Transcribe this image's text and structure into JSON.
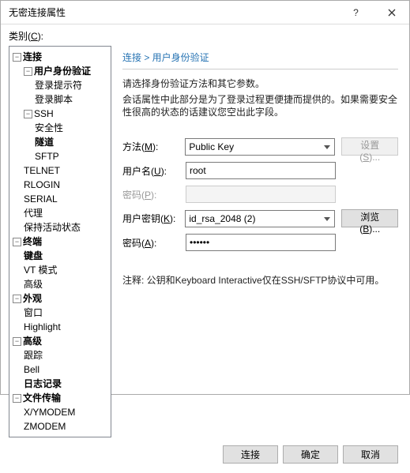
{
  "window": {
    "title": "无密连接属性"
  },
  "category_label": "类别",
  "category_hotkey": "C",
  "tree": {
    "conn": "连接",
    "auth": "用户身份验证",
    "loginprompt": "登录提示符",
    "loginscript": "登录脚本",
    "ssh": "SSH",
    "security": "安全性",
    "tunnel": "隧道",
    "sftp": "SFTP",
    "telnet": "TELNET",
    "rlogin": "RLOGIN",
    "serial": "SERIAL",
    "proxy": "代理",
    "keepalive": "保持活动状态",
    "terminal": "终端",
    "keyboard": "键盘",
    "vt": "VT 模式",
    "advanced1": "高级",
    "appearance": "外观",
    "windowitem": "窗口",
    "highlight": "Highlight",
    "advanced2": "高级",
    "trace": "跟踪",
    "bell": "Bell",
    "logging": "日志记录",
    "filetx": "文件传输",
    "xymodem": "X/YMODEM",
    "zmodem": "ZMODEM"
  },
  "breadcrumb": "连接 > 用户身份验证",
  "desc": "请选择身份验证方法和其它参数。",
  "hint": "会话属性中此部分是为了登录过程更便捷而提供的。如果需要安全性很高的状态的话建议您空出此字段。",
  "labels": {
    "method": "方法",
    "method_hk": "M",
    "user": "用户名",
    "user_hk": "U",
    "pass": "密码",
    "pass_hk": "P",
    "userkey": "用户密钥",
    "userkey_hk": "K",
    "passphrase": "密码",
    "passphrase_hk": "A"
  },
  "values": {
    "method": "Public Key",
    "user": "root",
    "pass": "",
    "userkey": "id_rsa_2048 (2)",
    "passphrase": "••••••"
  },
  "buttons": {
    "settings": "设置",
    "settings_hk": "S",
    "browse": "浏览",
    "browse_hk": "B",
    "connect": "连接",
    "ok": "确定",
    "cancel": "取消"
  },
  "note": "注释: 公钥和Keyboard Interactive仅在SSH/SFTP协议中可用。"
}
